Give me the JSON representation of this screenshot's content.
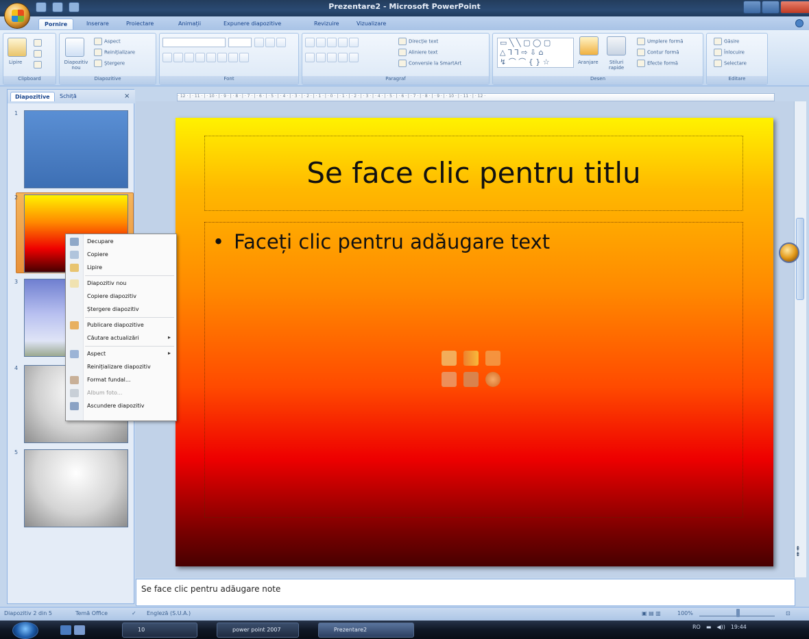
{
  "window": {
    "title": "Prezentare2 - Microsoft PowerPoint"
  },
  "tabs": [
    "Pornire",
    "Inserare",
    "Proiectare",
    "Animații",
    "Expunere diapozitive",
    "Revizuire",
    "Vizualizare"
  ],
  "ribbon": {
    "clipboard": {
      "label": "Clipboard",
      "paste": "Lipire"
    },
    "slides": {
      "label": "Diapozitive",
      "new_slide": "Diapozitiv nou",
      "layout": "Aspect",
      "reset": "Reinițializare",
      "delete": "Ștergere"
    },
    "font": {
      "label": "Font"
    },
    "paragraph": {
      "label": "Paragraf",
      "text_direction": "Direcție text",
      "align_text": "Aliniere text",
      "smartart": "Conversie la SmartArt"
    },
    "drawing": {
      "label": "Desen",
      "arrange": "Aranjare",
      "quick_styles": "Stiluri rapide",
      "shape_fill": "Umplere formă",
      "shape_outline": "Contur formă",
      "shape_effects": "Efecte formă"
    },
    "editing": {
      "label": "Editare",
      "find": "Găsire",
      "replace": "Înlocuire",
      "select": "Selectare"
    }
  },
  "panel": {
    "tab_slides": "Diapozitive",
    "tab_outline": "Schiță",
    "close": "×",
    "thumbnails": [
      "1",
      "2",
      "3",
      "4",
      "5"
    ]
  },
  "ruler": {
    "marks": "· 12 · | · 11 · | · 10 · | · 9 · | · 8 · | · 7 · | · 6 · | · 5 · | · 4 · | · 3 · | · 2 · | · 1 · | · 0 · | · 1 · | · 2 · | · 3 · | · 4 · | · 5 · | · 6 · | · 7 · | · 8 · | · 9 · | · 10 · | · 11 · | · 12 ·"
  },
  "slide": {
    "title_placeholder": "Se face clic pentru titlu",
    "body_placeholder": "Faceți clic pentru adăugare text",
    "bullet": "•"
  },
  "notes": {
    "placeholder": "Se face clic pentru adăugare note"
  },
  "context_menu": {
    "items": [
      {
        "label": "Decupare"
      },
      {
        "label": "Copiere"
      },
      {
        "label": "Lipire"
      },
      {
        "label": "Diapozitiv nou"
      },
      {
        "label": "Copiere diapozitiv"
      },
      {
        "label": "Ștergere diapozitiv"
      },
      {
        "label": "Publicare diapozitive"
      },
      {
        "label": "Căutare actualizări",
        "arrow": "▸"
      },
      {
        "label": "Aspect",
        "arrow": "▸"
      },
      {
        "label": "Reinițializare diapozitiv"
      },
      {
        "label": "Format fundal..."
      },
      {
        "label": "Album foto..."
      },
      {
        "label": "Ascundere diapozitiv"
      }
    ]
  },
  "status": {
    "slide_info": "Diapozitiv 2 din 5",
    "theme": "Temă Office",
    "language": "Engleză (S.U.A.)",
    "zoom": "100%"
  },
  "taskbar": {
    "items": [
      "10",
      "power point 2007",
      "Prezentare2"
    ],
    "tray": "RO",
    "clock": "19:44"
  },
  "colors": {
    "accent": "#15428b",
    "ribbon_bg": "#d2e2f4",
    "slide_top": "#fff200",
    "slide_bottom": "#470000"
  }
}
